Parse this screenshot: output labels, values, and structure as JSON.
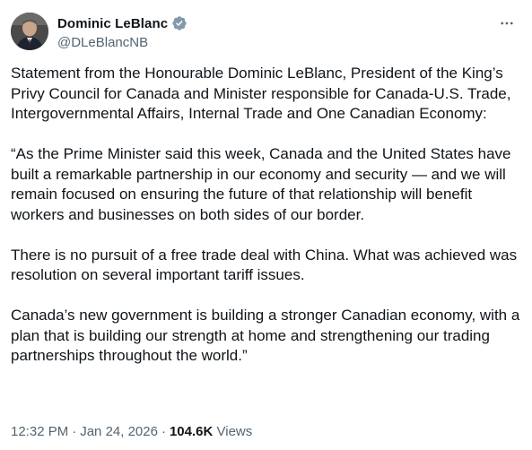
{
  "author": {
    "display_name": "Dominic LeBlanc",
    "handle": "@DLeBlancNB",
    "verified": true,
    "verified_color": "#829aab"
  },
  "tweet": {
    "paragraphs": [
      "Statement from the Honourable Dominic LeBlanc, President of the King’s Privy Council for Canada and Minister responsible for Canada-U.S. Trade, Intergovernmental Affairs, Internal Trade and One Canadian Economy:",
      "“As the Prime Minister said this week, Canada and the United States have built a remarkable partnership in our economy and security — and we will remain focused on ensuring the future of that relationship will benefit workers and businesses on both sides of our border.",
      "There is no pursuit of a free trade deal with China. What was achieved was resolution on several important tariff issues.",
      "Canada’s new government is building a stronger Canadian economy, with a plan that is building our strength at home and strengthening our trading partnerships throughout the world.”"
    ]
  },
  "meta": {
    "time": "12:32 PM",
    "separator": "·",
    "date": "Jan 24, 2026",
    "views_count": "104.6K",
    "views_label": "Views"
  },
  "icons": {
    "more": "more-horizontal-icon",
    "verified": "verified-badge-icon"
  },
  "colors": {
    "text_primary": "#0f1419",
    "text_secondary": "#536471"
  }
}
